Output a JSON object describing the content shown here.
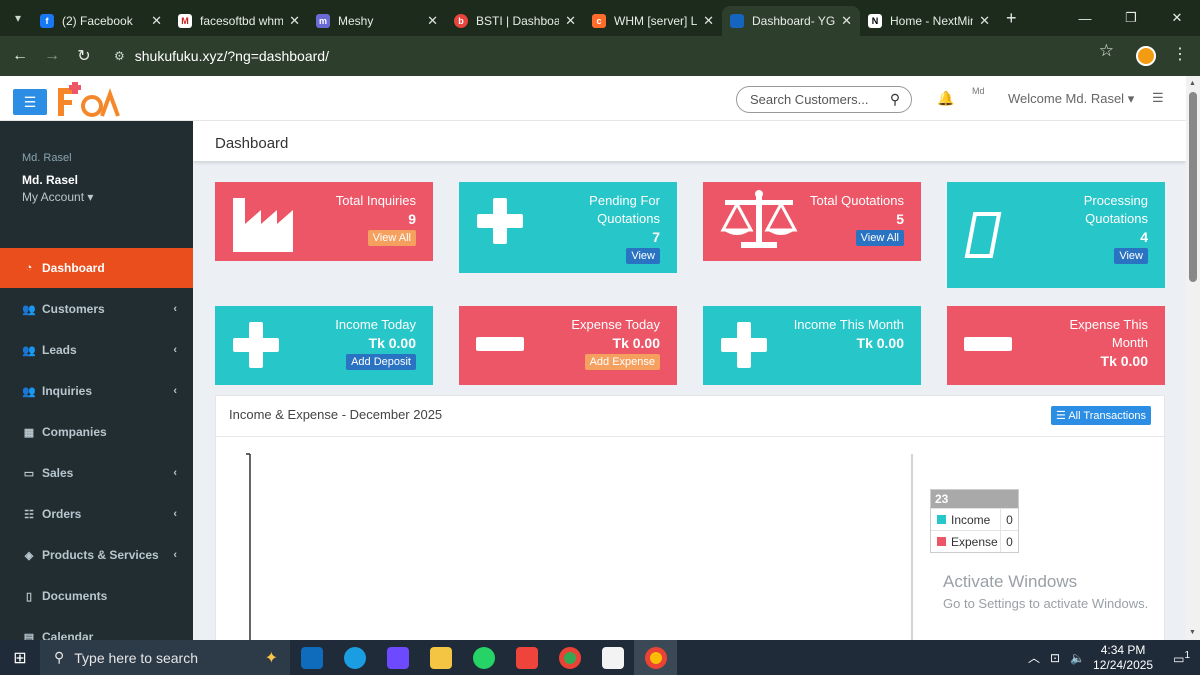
{
  "browser": {
    "tabs": [
      {
        "label": "(2) Facebook",
        "color": "#1877f2",
        "glyph": "f"
      },
      {
        "label": "facesoftbd whm",
        "color": "#c5221f",
        "glyph": "M"
      },
      {
        "label": "Meshy",
        "color": "#6b6bd6",
        "glyph": "m"
      },
      {
        "label": "BSTI | Dashboard",
        "color": "#e8453c",
        "glyph": "b"
      },
      {
        "label": "WHM [server] Li",
        "color": "#ff6c2c",
        "glyph": "c"
      },
      {
        "label": "Dashboard- YGE",
        "color": "#1565c0",
        "glyph": ""
      },
      {
        "label": "Home - NextMin",
        "color": "#ffffff",
        "glyph": "N"
      }
    ],
    "url": "shukufuku.xyz/?ng=dashboard/"
  },
  "topnav": {
    "search_placeholder": "Search Customers...",
    "avatar_alt": "Md",
    "welcome": "Welcome Md. Rasel"
  },
  "sidebar": {
    "user_img_alt": "Md. Rasel",
    "user_name": "Md. Rasel",
    "account": "My Account",
    "items": [
      {
        "label": "Dashboard",
        "icon": "dashboard-icon",
        "chevron": false
      },
      {
        "label": "Customers",
        "icon": "users-icon",
        "chevron": true
      },
      {
        "label": "Leads",
        "icon": "users-icon",
        "chevron": true
      },
      {
        "label": "Inquiries",
        "icon": "users-icon",
        "chevron": true
      },
      {
        "label": "Companies",
        "icon": "building-icon",
        "chevron": false
      },
      {
        "label": "Sales",
        "icon": "card-icon",
        "chevron": true
      },
      {
        "label": "Orders",
        "icon": "list-icon",
        "chevron": true
      },
      {
        "label": "Products & Services",
        "icon": "cube-icon",
        "chevron": true
      },
      {
        "label": "Documents",
        "icon": "file-icon",
        "chevron": false
      },
      {
        "label": "Calendar",
        "icon": "calendar-icon",
        "chevron": false
      }
    ]
  },
  "page": {
    "title": "Dashboard"
  },
  "stats": [
    {
      "title": "Total Inquiries",
      "value": "9",
      "button": "View All"
    },
    {
      "title": "Pending For Quotations",
      "value": "7",
      "button": "View"
    },
    {
      "title": "Total Quotations",
      "value": "5",
      "button": "View All"
    },
    {
      "title": "Processing Quotations",
      "value": "4",
      "button": "View"
    },
    {
      "title": "Income Today",
      "value": "Tk 0.00",
      "button": "Add Deposit"
    },
    {
      "title": "Expense Today",
      "value": "Tk 0.00",
      "button": "Add Expense"
    },
    {
      "title": "Income This Month",
      "value": "Tk 0.00",
      "button": ""
    },
    {
      "title": "Expense This Month",
      "value": "Tk 0.00",
      "button": ""
    }
  ],
  "panel": {
    "title": "Income & Expense - December 2025",
    "all_transactions": "All Transactions",
    "tooltip": {
      "header": "23",
      "rows": [
        {
          "label": "Income",
          "value": "0",
          "color": "#26c6c9"
        },
        {
          "label": "Expense",
          "value": "0",
          "color": "#ec5667"
        }
      ]
    }
  },
  "watermark": {
    "line1": "Activate Windows",
    "line2": "Go to Settings to activate Windows."
  },
  "taskbar": {
    "search_placeholder": "Type here to search",
    "time": "4:34 PM",
    "date": "12/24/2025",
    "notification_count": "1"
  },
  "colors": {
    "red": "#ec5667",
    "teal": "#26c6c9",
    "accent": "#ea4e1c",
    "sidebar": "#222d32"
  }
}
